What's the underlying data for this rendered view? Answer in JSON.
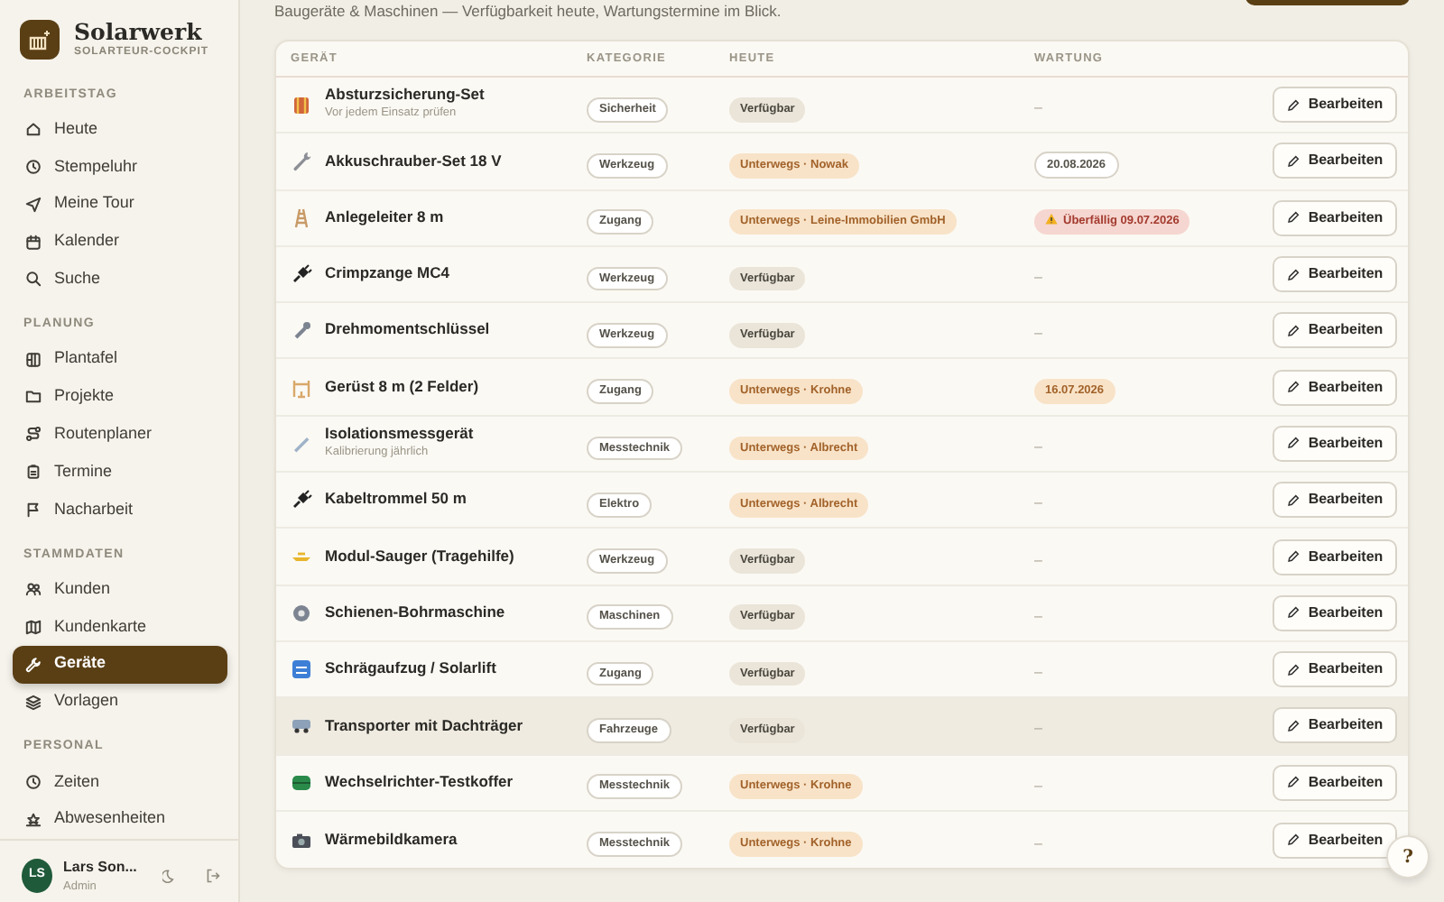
{
  "brand": {
    "name": "Solarwerk",
    "tagline": "SOLARTEUR-COCKPIT"
  },
  "sidebar": {
    "sections": [
      {
        "title": "ARBEITSTAG",
        "items": [
          {
            "label": "Heute",
            "selected": false
          },
          {
            "label": "Stempeluhr",
            "selected": false
          },
          {
            "label": "Meine Tour",
            "selected": false
          },
          {
            "label": "Kalender",
            "selected": false
          },
          {
            "label": "Suche",
            "selected": false
          }
        ]
      },
      {
        "title": "PLANUNG",
        "items": [
          {
            "label": "Plantafel",
            "selected": false
          },
          {
            "label": "Projekte",
            "selected": false
          },
          {
            "label": "Routenplaner",
            "selected": false
          },
          {
            "label": "Termine",
            "selected": false
          },
          {
            "label": "Nacharbeit",
            "selected": false
          }
        ]
      },
      {
        "title": "STAMMDATEN",
        "items": [
          {
            "label": "Kunden",
            "selected": false
          },
          {
            "label": "Kundenkarte",
            "selected": false
          },
          {
            "label": "Geräte",
            "selected": true
          },
          {
            "label": "Vorlagen",
            "selected": false
          }
        ]
      },
      {
        "title": "PERSONAL",
        "items": [
          {
            "label": "Zeiten",
            "selected": false
          },
          {
            "label": "Abwesenheiten",
            "selected": false
          }
        ]
      }
    ]
  },
  "user": {
    "initials": "LS",
    "name": "Lars Son...",
    "role": "Admin"
  },
  "subtitle": "Baugeräte & Maschinen — Verfügbarkeit heute, Wartungstermine im Blick.",
  "table": {
    "columns": [
      "GERÄT",
      "KATEGORIE",
      "HEUTE",
      "WARTUNG"
    ],
    "rows": [
      {
        "name": "Absturzsicherung-Set",
        "note": "Vor jedem Einsatz prüfen",
        "category": "Sicherheit",
        "status": {
          "kind": "available",
          "text": "Verfügbar"
        },
        "maintenance": {
          "kind": "none",
          "text": "–"
        },
        "action": "Bearbeiten",
        "highlighted": false
      },
      {
        "name": "Akkuschrauber-Set 18 V",
        "category": "Werkzeug",
        "status": {
          "kind": "away",
          "text": "Unterwegs · Nowak"
        },
        "maintenance": {
          "kind": "date",
          "text": "20.08.2026"
        },
        "action": "Bearbeiten",
        "highlighted": false
      },
      {
        "name": "Anlegeleiter 8 m",
        "category": "Zugang",
        "status": {
          "kind": "away",
          "text": "Unterwegs · Leine-Immobilien GmbH"
        },
        "maintenance": {
          "kind": "overdue",
          "text": "Überfällig 09.07.2026"
        },
        "action": "Bearbeiten",
        "highlighted": false
      },
      {
        "name": "Crimpzange MC4",
        "category": "Werkzeug",
        "status": {
          "kind": "available",
          "text": "Verfügbar"
        },
        "maintenance": {
          "kind": "none",
          "text": "–"
        },
        "action": "Bearbeiten",
        "highlighted": false
      },
      {
        "name": "Drehmomentschlüssel",
        "category": "Werkzeug",
        "status": {
          "kind": "available",
          "text": "Verfügbar"
        },
        "maintenance": {
          "kind": "none",
          "text": "–"
        },
        "action": "Bearbeiten",
        "highlighted": false
      },
      {
        "name": "Gerüst 8 m (2 Felder)",
        "category": "Zugang",
        "status": {
          "kind": "away",
          "text": "Unterwegs · Krohne"
        },
        "maintenance": {
          "kind": "soon",
          "text": "16.07.2026"
        },
        "action": "Bearbeiten",
        "highlighted": false
      },
      {
        "name": "Isolationsmessgerät",
        "note": "Kalibrierung jährlich",
        "category": "Messtechnik",
        "status": {
          "kind": "away",
          "text": "Unterwegs · Albrecht"
        },
        "maintenance": {
          "kind": "none",
          "text": "–"
        },
        "action": "Bearbeiten",
        "highlighted": false
      },
      {
        "name": "Kabeltrommel 50 m",
        "category": "Elektro",
        "status": {
          "kind": "away",
          "text": "Unterwegs · Albrecht"
        },
        "maintenance": {
          "kind": "none",
          "text": "–"
        },
        "action": "Bearbeiten",
        "highlighted": false
      },
      {
        "name": "Modul-Sauger (Tragehilfe)",
        "category": "Werkzeug",
        "status": {
          "kind": "available",
          "text": "Verfügbar"
        },
        "maintenance": {
          "kind": "none",
          "text": "–"
        },
        "action": "Bearbeiten",
        "highlighted": false
      },
      {
        "name": "Schienen-Bohrmaschine",
        "category": "Maschinen",
        "status": {
          "kind": "available",
          "text": "Verfügbar"
        },
        "maintenance": {
          "kind": "none",
          "text": "–"
        },
        "action": "Bearbeiten",
        "highlighted": false
      },
      {
        "name": "Schrägaufzug / Solarlift",
        "category": "Zugang",
        "status": {
          "kind": "available",
          "text": "Verfügbar"
        },
        "maintenance": {
          "kind": "none",
          "text": "–"
        },
        "action": "Bearbeiten",
        "highlighted": false
      },
      {
        "name": "Transporter mit Dachträger",
        "category": "Fahrzeuge",
        "status": {
          "kind": "available",
          "text": "Verfügbar"
        },
        "maintenance": {
          "kind": "none",
          "text": "–"
        },
        "action": "Bearbeiten",
        "highlighted": true
      },
      {
        "name": "Wechselrichter-Testkoffer",
        "category": "Messtechnik",
        "status": {
          "kind": "away",
          "text": "Unterwegs · Krohne"
        },
        "maintenance": {
          "kind": "none",
          "text": "–"
        },
        "action": "Bearbeiten",
        "highlighted": false
      },
      {
        "name": "Wärmebildkamera",
        "category": "Messtechnik",
        "status": {
          "kind": "away",
          "text": "Unterwegs · Krohne"
        },
        "maintenance": {
          "kind": "none",
          "text": "–"
        },
        "action": "Bearbeiten",
        "highlighted": false
      }
    ]
  },
  "help_button": "?"
}
